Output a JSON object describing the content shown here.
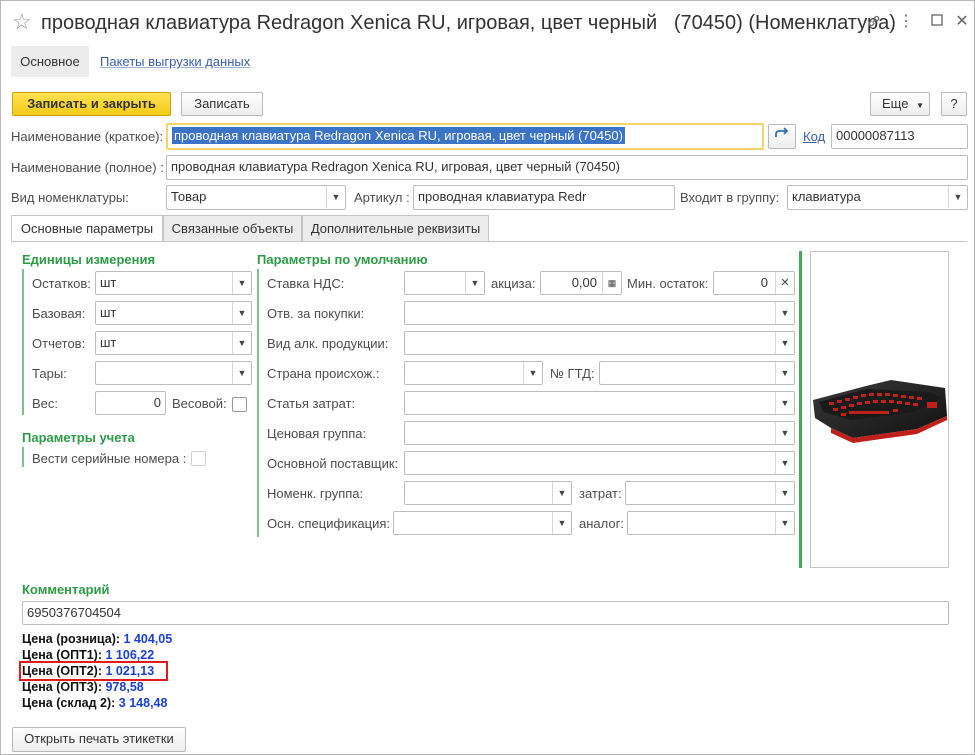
{
  "window": {
    "title": "проводная клавиатура Redragon Xenica RU, игровая, цвет черный   (70450) (Номенклатура)"
  },
  "nav": {
    "main_tab": "Основное",
    "link": "Пакеты выгрузки данных"
  },
  "toolbar": {
    "save_close": "Записать и закрыть",
    "save": "Записать",
    "more": "Еще",
    "help": "?"
  },
  "form": {
    "short_name_label": "Наименование (краткое):",
    "short_name_value": "проводная клавиатура Redragon Xenica RU, игровая, цвет черный   (70450)",
    "code_link": "Код",
    "code_value": "00000087113",
    "full_name_label": "Наименование (полное) :",
    "full_name_value": "проводная клавиатура Redragon Xenica RU, игровая, цвет черный   (70450)",
    "type_label": "Вид номенклатуры:",
    "type_value": "Товар",
    "article_label": "Артикул :",
    "article_value": "проводная клавиатура Redr",
    "group_label": "Входит в группу:",
    "group_value": "клавиатура"
  },
  "tabs": [
    {
      "label": "Основные параметры"
    },
    {
      "label": "Связанные объекты"
    },
    {
      "label": "Дополнительные реквизиты"
    }
  ],
  "units": {
    "heading": "Единицы измерения",
    "rows": [
      {
        "label": "Остатков:",
        "value": "шт"
      },
      {
        "label": "Базовая:",
        "value": "шт"
      },
      {
        "label": "Отчетов:",
        "value": "шт"
      },
      {
        "label": "Тары:",
        "value": ""
      }
    ],
    "weight_label": "Вес:",
    "weight_value": "0",
    "weighted_label": "Весовой:"
  },
  "accounting": {
    "heading": "Параметры учета",
    "serial_label": "Вести серийные номера :"
  },
  "defaults": {
    "heading": "Параметры по умолчанию",
    "vat_label": "Ставка НДС:",
    "excise_label": "акциза:",
    "excise_value": "0,00",
    "min_stock_label": "Мин. остаток:",
    "min_stock_value": "0",
    "buyer_label": "Отв. за покупки:",
    "alc_label": "Вид алк. продукции:",
    "country_label": "Страна происхож.:",
    "gtd_label": "№ ГТД:",
    "cost_item_label": "Статья затрат:",
    "price_group_label": "Ценовая группа:",
    "supplier_label": "Основной поставщик:",
    "nom_group_label": "Номенк.  группа:",
    "costs_label": "затрат:",
    "spec_label": "Осн. спецификация:",
    "analog_label": "аналог:"
  },
  "comment": {
    "heading": "Комментарий",
    "value": "6950376704504"
  },
  "prices": [
    {
      "label": "Цена (розница):",
      "value": "1 404,05"
    },
    {
      "label": "Цена (ОПТ1):",
      "value": "1 106,22"
    },
    {
      "label": "Цена (ОПТ2):",
      "value": "1 021,13"
    },
    {
      "label": "Цена (ОПТ3):",
      "value": "978,58"
    },
    {
      "label": "Цена (склад 2):",
      "value": "3 148,48"
    }
  ],
  "footer": {
    "print_label_button": "Открыть печать этикетки"
  }
}
